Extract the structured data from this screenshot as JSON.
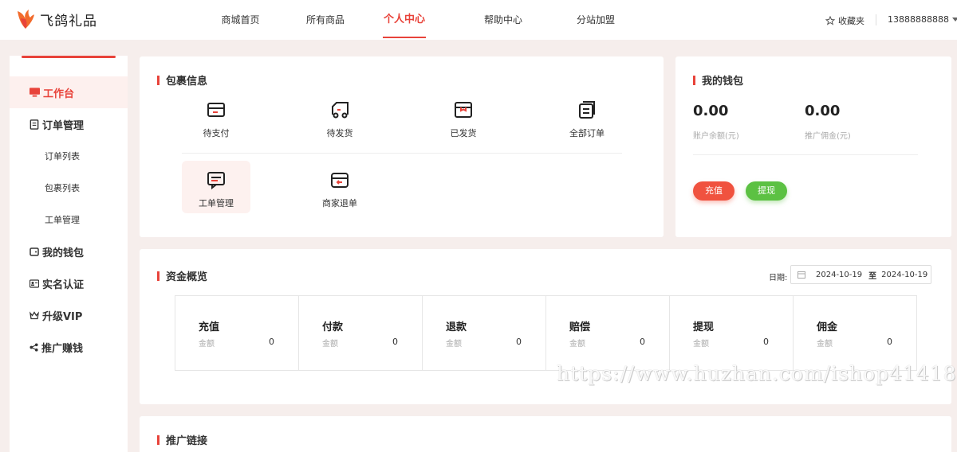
{
  "brand": {
    "name": "飞鸽礼品",
    "accent": "#e8433a"
  },
  "nav": {
    "items": [
      {
        "label": "商城首页"
      },
      {
        "label": "所有商品"
      },
      {
        "label": "个人中心",
        "active": true
      },
      {
        "label": "帮助中心"
      },
      {
        "label": "分站加盟"
      }
    ],
    "favorites": "收藏夹",
    "user": "13888888888"
  },
  "sidebar": {
    "items": [
      {
        "label": "工作台",
        "icon": "monitor-icon",
        "active": true
      },
      {
        "label": "订单管理",
        "icon": "clipboard-icon"
      },
      {
        "label": "订单列表"
      },
      {
        "label": "包裹列表"
      },
      {
        "label": "工单管理"
      },
      {
        "label": "我的钱包",
        "icon": "wallet-icon"
      },
      {
        "label": "实名认证",
        "icon": "id-card-icon"
      },
      {
        "label": "升级VIP",
        "icon": "crown-icon"
      },
      {
        "label": "推广赚钱",
        "icon": "share-icon"
      }
    ]
  },
  "package": {
    "title": "包裹信息",
    "items": [
      {
        "label": "待支付",
        "icon": "card-icon"
      },
      {
        "label": "待发货",
        "icon": "truck-icon"
      },
      {
        "label": "已发货",
        "icon": "box-icon"
      },
      {
        "label": "全部订单",
        "icon": "orders-icon"
      },
      {
        "label": "工单管理",
        "icon": "ticket-icon"
      },
      {
        "label": "商家退单",
        "icon": "return-box-icon"
      }
    ]
  },
  "wallet": {
    "title": "我的钱包",
    "balance": "0.00",
    "balance_label": "账户余额(元)",
    "commission": "0.00",
    "commission_label": "推广佣金(元)",
    "recharge_btn": "充值",
    "withdraw_btn": "提现",
    "colors": {
      "recharge": "#f0523f",
      "withdraw": "#5cc143"
    }
  },
  "funds": {
    "title": "资金概览",
    "date_label": "日期:",
    "date_from": "2024-10-19",
    "date_sep": "至",
    "date_to": "2024-10-19",
    "items": [
      {
        "name": "充值",
        "caption": "金额",
        "value": "0"
      },
      {
        "name": "付款",
        "caption": "金额",
        "value": "0"
      },
      {
        "name": "退款",
        "caption": "金额",
        "value": "0"
      },
      {
        "name": "赔偿",
        "caption": "金额",
        "value": "0"
      },
      {
        "name": "提现",
        "caption": "金额",
        "value": "0"
      },
      {
        "name": "佣金",
        "caption": "金额",
        "value": "0"
      }
    ]
  },
  "promo": {
    "title": "推广链接"
  },
  "watermark": "https://www.huzhan.com/ishop41418"
}
